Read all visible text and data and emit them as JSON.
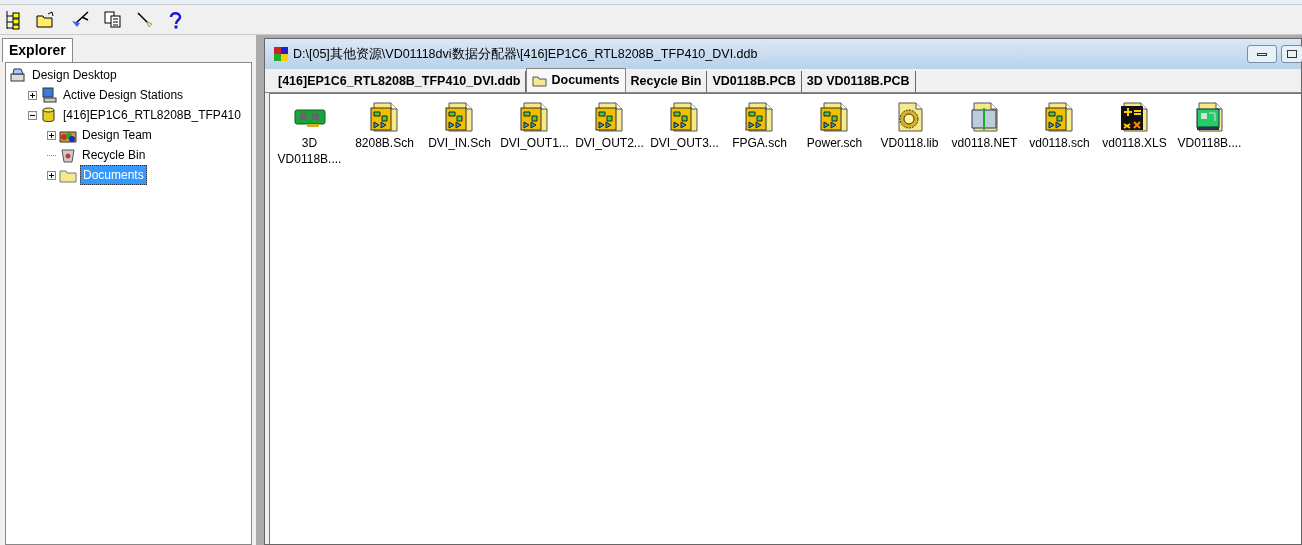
{
  "explorer": {
    "tab": "Explorer",
    "tree": [
      {
        "label": "Design Desktop",
        "kind": "desktop",
        "selected": false,
        "children": [
          {
            "label": "Active Design Stations",
            "kind": "station",
            "expanded": false,
            "selected": false
          },
          {
            "label": "[416]EP1C6_RTL8208B_TFP410",
            "kind": "database",
            "expanded": true,
            "selected": false,
            "children": [
              {
                "label": "Design Team",
                "kind": "team",
                "expanded": false,
                "selected": false
              },
              {
                "label": "Recycle Bin",
                "kind": "bin",
                "selected": false
              },
              {
                "label": "Documents",
                "kind": "folder",
                "expanded": false,
                "selected": true
              }
            ]
          }
        ]
      }
    ]
  },
  "window": {
    "title": "D:\\[05]其他资源\\VD01118dvi数据分配器\\[416]EP1C6_RTL8208B_TFP410_DVI.ddb",
    "tabs": [
      {
        "label": "[416]EP1C6_RTL8208B_TFP410_DVI.ddb",
        "kind": "plain",
        "selected": false
      },
      {
        "label": "Documents",
        "kind": "folder",
        "selected": true
      },
      {
        "label": "Recycle Bin",
        "kind": "plain",
        "selected": false
      },
      {
        "label": "VD0118B.PCB",
        "kind": "plain",
        "selected": false
      },
      {
        "label": "3D VD0118B.PCB",
        "kind": "plain",
        "selected": false
      }
    ],
    "files": [
      {
        "name": "3D VD0118B....",
        "kind": "pcb3d"
      },
      {
        "name": "8208B.Sch",
        "kind": "sch"
      },
      {
        "name": "DVI_IN.Sch",
        "kind": "sch"
      },
      {
        "name": "DVI_OUT1...",
        "kind": "sch"
      },
      {
        "name": "DVI_OUT2...",
        "kind": "sch"
      },
      {
        "name": "DVI_OUT3...",
        "kind": "sch"
      },
      {
        "name": "FPGA.sch",
        "kind": "sch"
      },
      {
        "name": "Power.sch",
        "kind": "sch"
      },
      {
        "name": "VD0118.lib",
        "kind": "lib"
      },
      {
        "name": "vd0118.NET",
        "kind": "net"
      },
      {
        "name": "vd0118.sch",
        "kind": "sch"
      },
      {
        "name": "vd0118.XLS",
        "kind": "xls"
      },
      {
        "name": "VD0118B....",
        "kind": "pcb"
      }
    ]
  }
}
